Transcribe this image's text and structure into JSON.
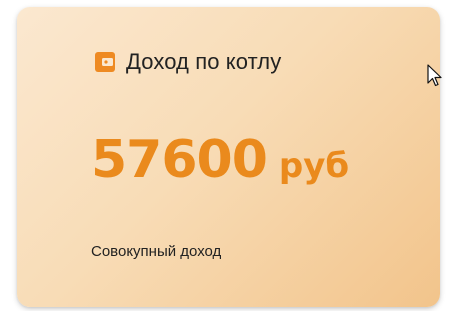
{
  "card": {
    "title": "Доход по котлу",
    "icon": "wallet-icon",
    "amount": "57600",
    "unit": "руб",
    "caption": "Совокупный доход"
  },
  "colors": {
    "accent": "#ea8a1d",
    "icon": "#ee8a22",
    "gradient_start": "#fbe8d0",
    "gradient_end": "#f2c48b",
    "text": "#222222"
  }
}
